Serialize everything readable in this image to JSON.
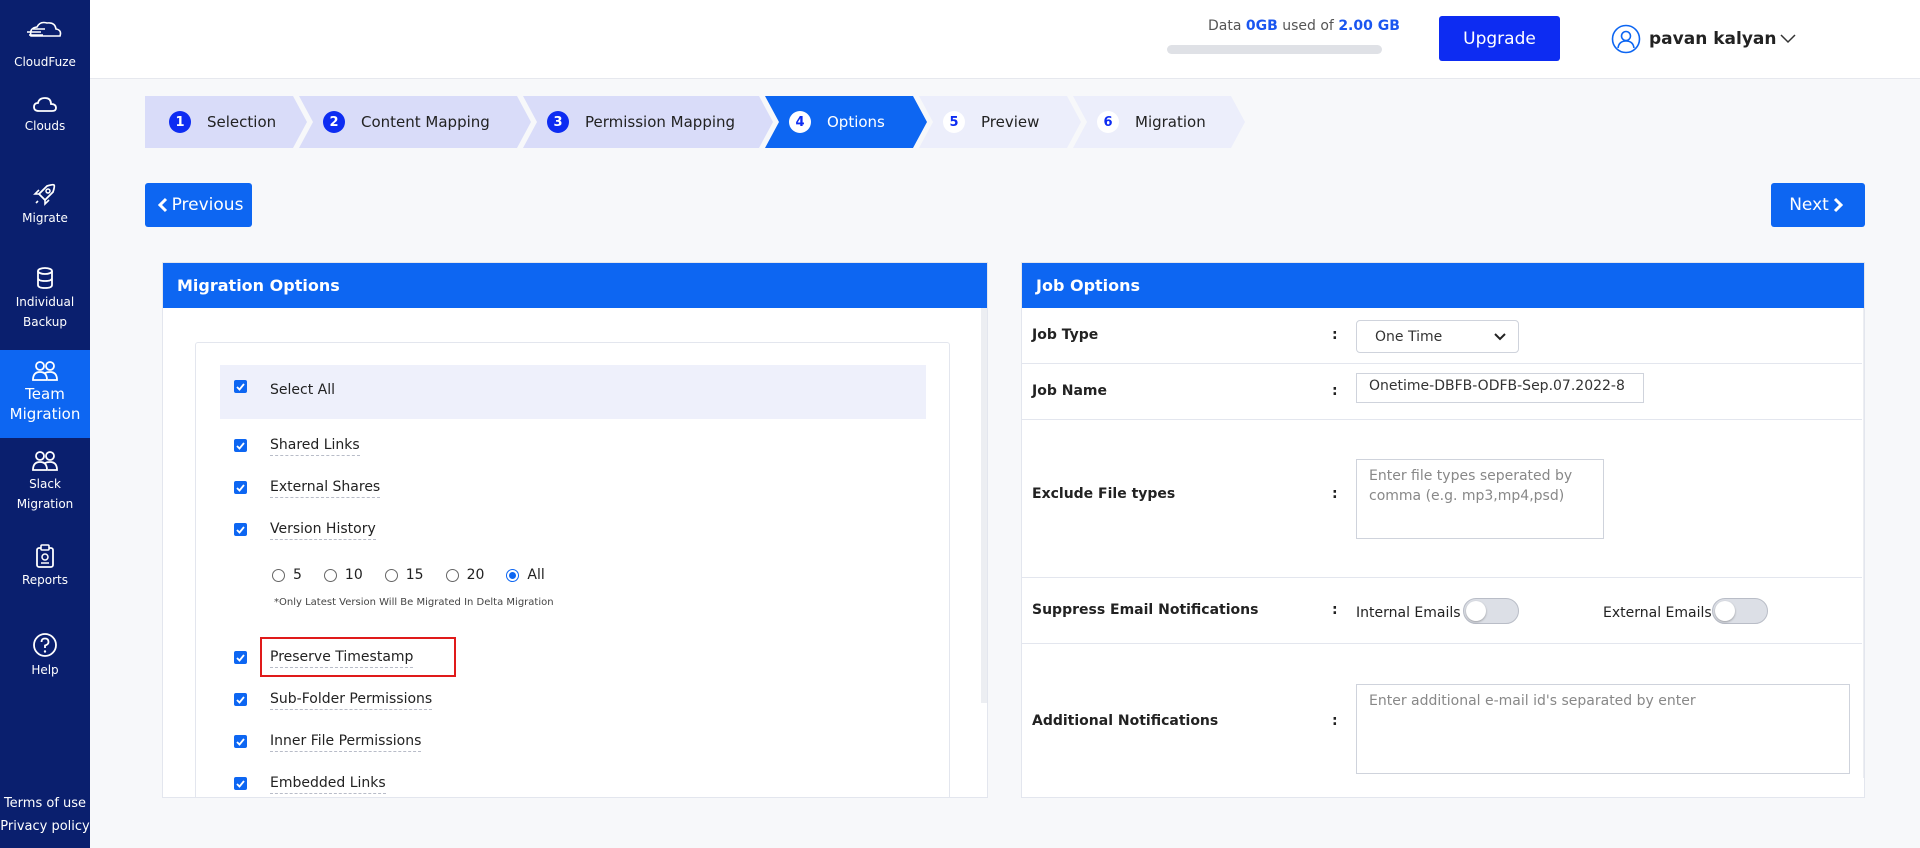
{
  "sidebar": {
    "logo": "CloudFuze",
    "items": [
      {
        "label": "Clouds"
      },
      {
        "label": "Migrate"
      },
      {
        "label": "Individual Backup"
      },
      {
        "label": "Team Migration"
      },
      {
        "label": "Slack Migration"
      },
      {
        "label": "Reports"
      },
      {
        "label": "Help"
      }
    ],
    "footer": {
      "terms": "Terms of use",
      "privacy": "Privacy policy"
    }
  },
  "header": {
    "data_prefix": "Data ",
    "data_used": "0GB",
    "data_mid": " used of ",
    "data_total": "2.00 GB",
    "usage_fraction": 0,
    "upgrade_label": "Upgrade",
    "user_name": "pavan kalyan"
  },
  "steps": [
    {
      "num": "1",
      "label": "Selection"
    },
    {
      "num": "2",
      "label": "Content Mapping"
    },
    {
      "num": "3",
      "label": "Permission Mapping"
    },
    {
      "num": "4",
      "label": "Options"
    },
    {
      "num": "5",
      "label": "Preview"
    },
    {
      "num": "6",
      "label": "Migration"
    }
  ],
  "nav": {
    "previous": "Previous",
    "next": "Next"
  },
  "migration_options": {
    "title": "Migration Options",
    "select_all": "Select All",
    "options": {
      "shared_links": "Shared Links",
      "external_shares": "External Shares",
      "version_history": "Version History",
      "preserve_timestamp": "Preserve Timestamp",
      "sub_folder_permissions": "Sub-Folder Permissions",
      "inner_file_permissions": "Inner File Permissions",
      "embedded_links": "Embedded Links"
    },
    "versions": [
      "5",
      "10",
      "15",
      "20",
      "All"
    ],
    "selected_version": "All",
    "note": "*Only Latest Version Will Be Migrated In Delta Migration"
  },
  "job_options": {
    "title": "Job Options",
    "job_type_label": "Job Type",
    "job_type_value": "One Time",
    "job_name_label": "Job Name",
    "job_name_value": "Onetime-DBFB-ODFB-Sep.07.2022-8",
    "exclude_label": "Exclude File types",
    "exclude_placeholder": "Enter file types seperated by comma (e.g. mp3,mp4,psd)",
    "suppress_label": "Suppress Email Notifications",
    "internal_emails": "Internal Emails",
    "external_emails": "External Emails",
    "additional_label": "Additional Notifications",
    "additional_placeholder": "Enter additional e-mail id's separated by enter",
    "colon": ":"
  },
  "colors": {
    "sidebar": "#0a1f6e",
    "primary": "#0d66f2",
    "accent": "#0d2cf2",
    "highlight": "#e01a1a"
  }
}
